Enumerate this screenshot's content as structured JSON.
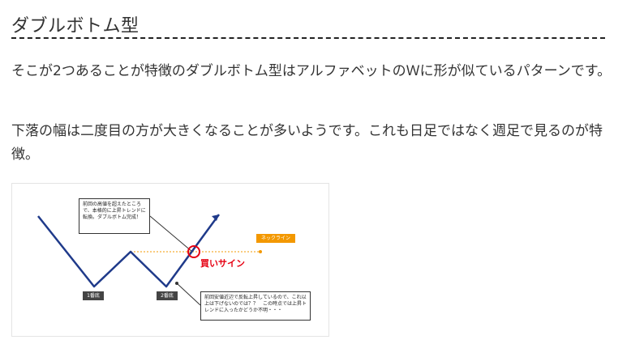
{
  "heading": "ダブルボトム型",
  "paragraphs": [
    "そこが2つあることが特徴のダブルボトム型はアルファベットのＷに形が似ているパターンです。",
    "下落の幅は二度目の方が大きくなることが多いようです。これも日足ではなく週足で見るのが特徴。"
  ],
  "figure": {
    "callout_top": "前回の高値を超えたところで、本格的に上昇トレンドに転換。ダブルボトム完成！",
    "callout_bottom": "前回安値近辺で反転上昇しているので、これ以上は下げないのでは？？　この時点では上昇トレンドに入ったかどうか不明・・・",
    "bottom1_label": "1番底",
    "bottom2_label": "2番底",
    "neckline_label": "ネックライン",
    "buy_signal_label": "買いサイン",
    "colors": {
      "price_line": "#1f3a8a",
      "neckline": "#f39800",
      "buy_signal": "#e60012",
      "label_bg": "#444444"
    }
  }
}
